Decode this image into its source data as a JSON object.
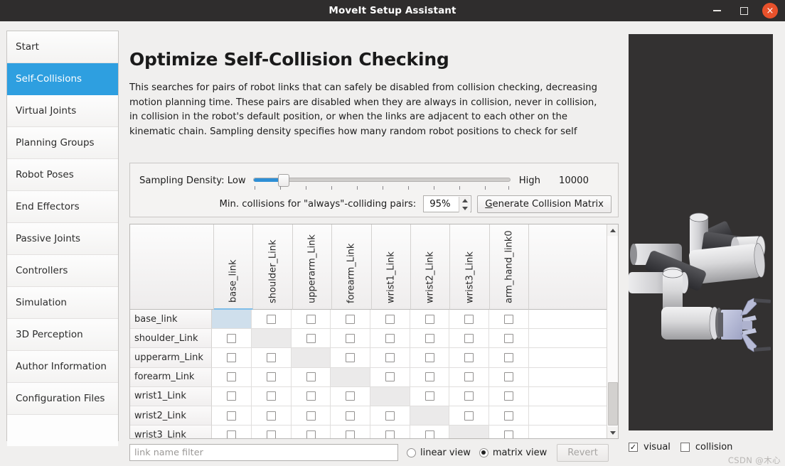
{
  "window": {
    "title": "MoveIt Setup Assistant",
    "controls": {
      "minimize": "minimize-icon",
      "maximize": "maximize-icon",
      "close": "×"
    }
  },
  "sidebar": {
    "items": [
      {
        "label": "Start",
        "selected": false
      },
      {
        "label": "Self-Collisions",
        "selected": true
      },
      {
        "label": "Virtual Joints",
        "selected": false
      },
      {
        "label": "Planning Groups",
        "selected": false
      },
      {
        "label": "Robot Poses",
        "selected": false
      },
      {
        "label": "End Effectors",
        "selected": false
      },
      {
        "label": "Passive Joints",
        "selected": false
      },
      {
        "label": "Controllers",
        "selected": false
      },
      {
        "label": "Simulation",
        "selected": false
      },
      {
        "label": "3D Perception",
        "selected": false
      },
      {
        "label": "Author Information",
        "selected": false
      },
      {
        "label": "Configuration Files",
        "selected": false
      }
    ]
  },
  "main": {
    "title": "Optimize Self-Collision Checking",
    "description": "This searches for pairs of robot links that can safely be disabled from collision checking, decreasing motion planning time. These pairs are disabled when they are always in collision, never in collision, in collision in the robot's default position, or when the links are adjacent to each other on the kinematic chain. Sampling density specifies how many random robot positions to check for self",
    "density": {
      "label": "Sampling Density: Low",
      "high_label": "High",
      "value": "10000",
      "slider_percent": 10,
      "min_collisions_label": "Min. collisions for \"always\"-colliding pairs:",
      "spin_value": "95%",
      "generate_button": "Generate Collision Matrix",
      "generate_button_mnemonic": "G"
    },
    "matrix": {
      "columns": [
        "base_link",
        "shoulder_Link",
        "upperarm_Link",
        "forearm_Link",
        "wrist1_Link",
        "wrist2_Link",
        "wrist3_Link",
        "arm_hand_link0"
      ],
      "rows": [
        "base_link",
        "shoulder_Link",
        "upperarm_Link",
        "forearm_Link",
        "wrist1_Link",
        "wrist2_Link",
        "wrist3_Link"
      ],
      "selected_cell": {
        "row": 0,
        "col": 0
      }
    },
    "bottom": {
      "filter_placeholder": "link name filter",
      "filter_value": "",
      "view_linear": "linear view",
      "view_matrix": "matrix view",
      "selected_view": "matrix",
      "revert_button": "Revert",
      "revert_enabled": false
    }
  },
  "viewport": {
    "visual_label": "visual",
    "visual_checked": true,
    "visual_check_glyph": "✓",
    "collision_label": "collision",
    "collision_checked": false,
    "background_color": "#333131",
    "robot_color": "#d7d7d9",
    "gripper_color": "#b9bcd8"
  },
  "watermark": "CSDN @木心"
}
